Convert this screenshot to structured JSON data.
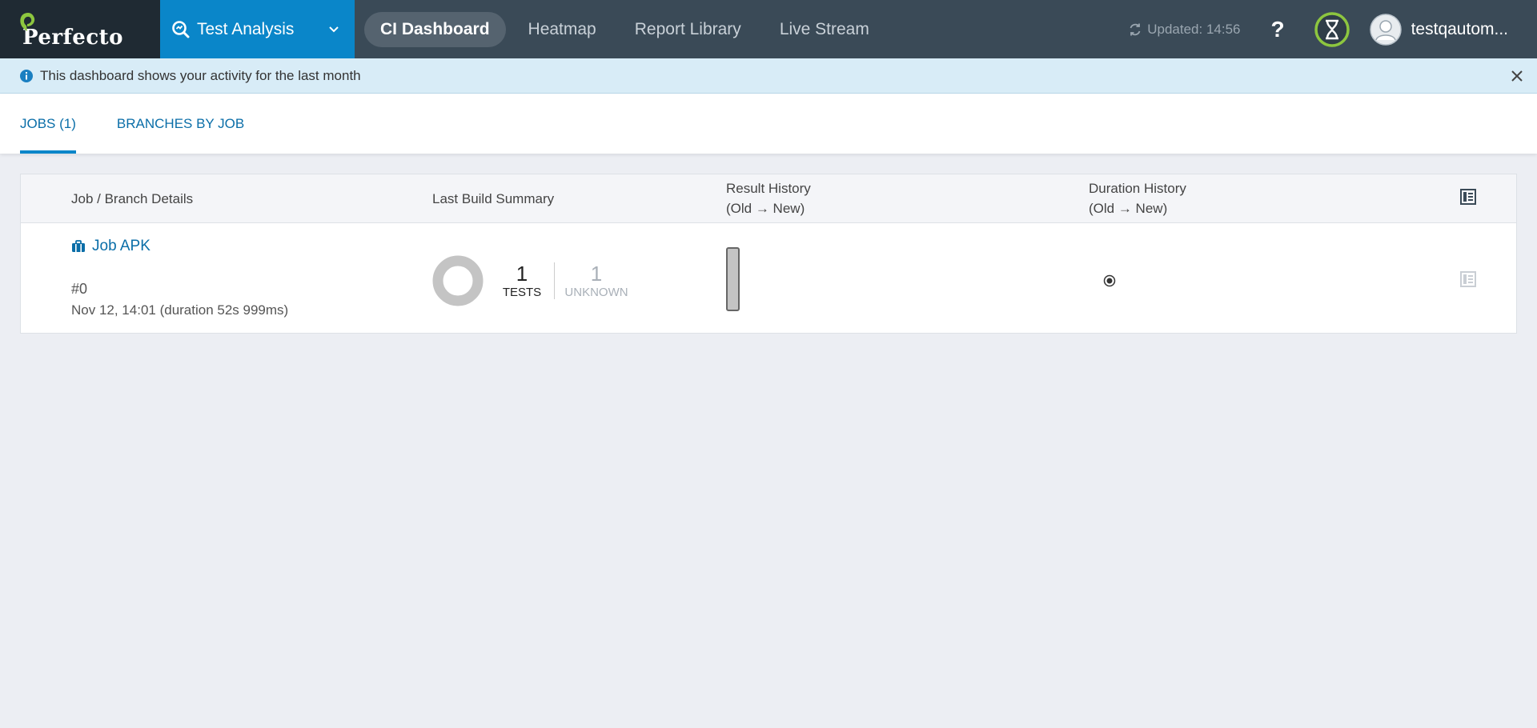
{
  "header": {
    "logo_text": "Perfecto",
    "product": "Test Analysis",
    "tabs": [
      {
        "label": "CI Dashboard",
        "active": true
      },
      {
        "label": "Heatmap",
        "active": false
      },
      {
        "label": "Report Library",
        "active": false
      },
      {
        "label": "Live Stream",
        "active": false
      }
    ],
    "updated": "Updated: 14:56",
    "help": "?",
    "username": "testqautom..."
  },
  "banner": {
    "text": "This dashboard shows your activity for the last month"
  },
  "subtabs": [
    {
      "label": "JOBS (1)",
      "active": true
    },
    {
      "label": "BRANCHES BY JOB",
      "active": false
    }
  ],
  "table": {
    "headers": {
      "job": "Job / Branch Details",
      "summary": "Last Build Summary",
      "result": "Result History",
      "result_sub": "(Old → New)",
      "duration": "Duration History",
      "duration_sub": "(Old → New)"
    },
    "rows": [
      {
        "job_name": "Job APK",
        "build_number": "#0",
        "build_date": "Nov 12, 14:01 (duration 52s 999ms)",
        "tests_count": "1",
        "tests_label": "TESTS",
        "unknown_count": "1",
        "unknown_label": "UNKNOWN"
      }
    ]
  },
  "colors": {
    "nav_bg": "#3a4a57",
    "product_bg": "#0a86c9",
    "link": "#0a6ea8",
    "banner_bg": "#d8ecf7",
    "timer_ring": "#8dc63f",
    "donut_unknown": "#c4c4c4"
  }
}
